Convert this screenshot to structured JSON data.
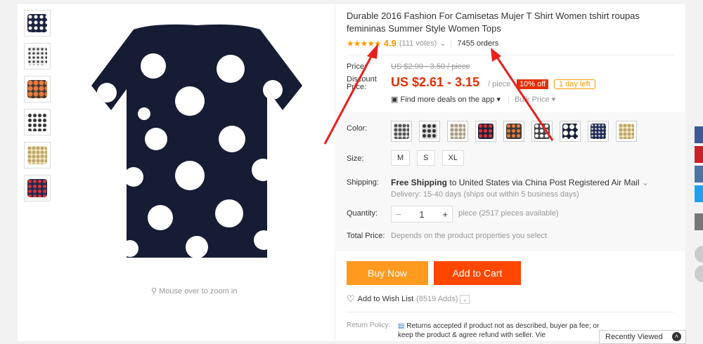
{
  "product": {
    "title": "Durable 2016 Fashion For Camisetas Mujer T Shirt Women tshirt roupas femininas Summer Style Women Tops",
    "stars": "★★★★★",
    "rating": "4.9",
    "votes": "(111 votes)",
    "orders": "7455 orders",
    "zoom_hint": "Mouse over to zoom in"
  },
  "price": {
    "price_label": "Price:",
    "old_price": "US $2.90 - 3.50 / piece",
    "discount_label": "Discount Price:",
    "current": "US $2.61 - 3.15",
    "unit": "/ piece",
    "off_badge": "10% off",
    "days_left": "1 day left",
    "deals_app": "Find more deals on the app",
    "bulk_price": "Bulk Price"
  },
  "options": {
    "color_label": "Color:",
    "size_label": "Size:",
    "sizes": [
      "M",
      "S",
      "XL"
    ],
    "shipping_label": "Shipping:",
    "shipping_bold": "Free Shipping",
    "shipping_rest": "to United States via China Post Registered Air Mail",
    "delivery": "Delivery: 15-40 days (ships out within 5 business days)",
    "quantity_label": "Quantity:",
    "quantity": "1",
    "availability": "piece (2517 pieces available)",
    "total_label": "Total Price:",
    "total_text": "Depends on the product properties you select"
  },
  "actions": {
    "buy_now": "Buy Now",
    "add_to_cart": "Add to Cart",
    "wish_list": "Add to Wish List",
    "wish_count": "(8519 Adds)"
  },
  "policy": {
    "return_label": "Return Policy:",
    "return_text": "Returns accepted if product not as described, buyer pa fee; or keep the product & agree refund with seller. Vie"
  },
  "footer": {
    "recently_viewed": "Recently Viewed"
  },
  "colors": {
    "accent_orange": "#ff9a1f",
    "cart_red": "#ff4700",
    "price_red": "#e62e04",
    "arrow_red": "#e8201c",
    "facebook": "#3b5998",
    "pinterest": "#cb2027",
    "vk": "#4c75a3",
    "twitter": "#1da1f2"
  },
  "icons": [
    "zoom-icon",
    "phone-icon",
    "heart-icon",
    "policy-icon",
    "chevron-up-icon",
    "facebook-icon",
    "pinterest-icon",
    "vk-icon",
    "twitter-icon"
  ]
}
